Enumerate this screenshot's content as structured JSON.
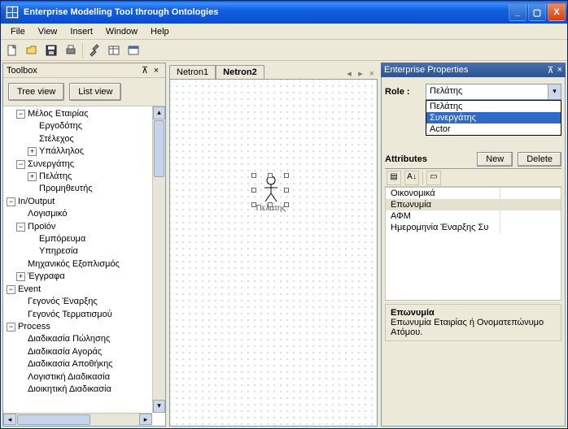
{
  "window": {
    "title": "Enterprise Modelling Tool through Ontologies"
  },
  "menu": {
    "file": "File",
    "view": "View",
    "insert": "Insert",
    "window": "Window",
    "help": "Help"
  },
  "toolbox": {
    "title": "Toolbox",
    "tree_view": "Tree view",
    "list_view": "List view",
    "tree": {
      "n1": "Μέλος Εταιρίας",
      "n1a": "Εργοδότης",
      "n1b": "Στέλεχος",
      "n1c": "Υπάλληλος",
      "n2": "Συνεργάτης",
      "n2a": "Πελάτης",
      "n2b": "Προμηθευτής",
      "n3": "In/Output",
      "n3a": "Λογισμικό",
      "n3b": "Προϊόν",
      "n3b1": "Εμπόρευμα",
      "n3b2": "Υπηρεσία",
      "n3c": "Μηχανικός Εξοπλισμός",
      "n3d": "Έγγραφα",
      "n4": "Event",
      "n4a": "Γεγονός Έναρξης",
      "n4b": "Γεγονός Τερματισμού",
      "n5": "Process",
      "n5a": "Διαδικασία Πώλησης",
      "n5b": "Διαδικασία Αγοράς",
      "n5c": "Διαδικασία Αποθήκης",
      "n5d": "Λογιστική Διαδικασία",
      "n5e": "Διοικητική Διαδικασία"
    }
  },
  "canvas": {
    "tab1": "Netron1",
    "tab2": "Netron2",
    "actor_label": "Πελάτης"
  },
  "props": {
    "title": "Enterprise Properties",
    "role_label": "Role :",
    "role_selected": "Πελάτης",
    "role_options": {
      "o1": "Πελάτης",
      "o2": "Συνεργάτης",
      "o3": "Actor"
    },
    "attributes_label": "Attributes",
    "new_btn": "New",
    "delete_btn": "Delete",
    "rows": {
      "r1": "Οικονομικά",
      "r2": "Επωνυμία",
      "r3": "ΑΦΜ",
      "r4": "Ημερομηνία Έναρξης Συ"
    },
    "desc_title": "Επωνυμία",
    "desc_text": "Επωνυμία Εταιρίας ή Ονοματεπώνυμο Ατόμου."
  }
}
